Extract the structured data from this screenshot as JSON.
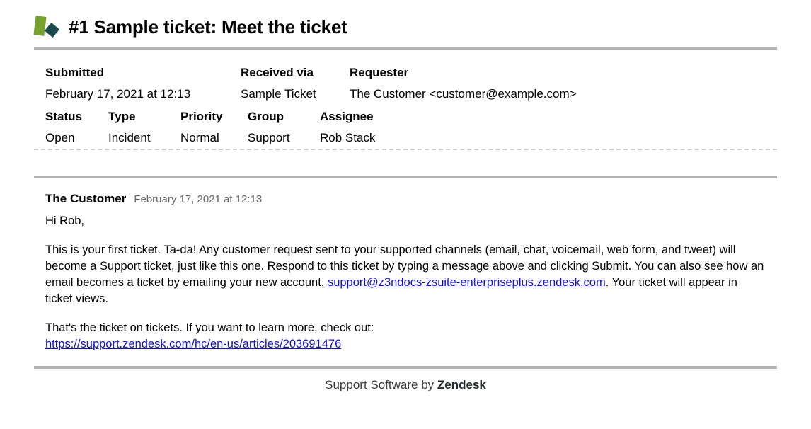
{
  "header": {
    "logo_icon": "zendesk-logo-icon",
    "title": "#1 Sample ticket: Meet the ticket"
  },
  "meta": {
    "row1": [
      {
        "label": "Submitted",
        "value": "February 17, 2021 at 12:13"
      },
      {
        "label": "Received via",
        "value": "Sample Ticket"
      },
      {
        "label": "Requester",
        "value": "The Customer <customer@example.com>"
      }
    ],
    "row2": [
      {
        "label": "Status",
        "value": "Open"
      },
      {
        "label": "Type",
        "value": "Incident"
      },
      {
        "label": "Priority",
        "value": "Normal"
      },
      {
        "label": "Group",
        "value": "Support"
      },
      {
        "label": "Assignee",
        "value": "Rob Stack"
      }
    ]
  },
  "comment": {
    "author": "The Customer",
    "date": "February 17, 2021 at 12:13",
    "greeting": "Hi Rob,",
    "paragraph_1_part_1": "This is your first ticket. Ta-da! Any customer request sent to your supported channels (email, chat, voicemail, web form, and tweet) will become a Support ticket, just like this one. Respond to this ticket by typing a message above and clicking Submit. You can also see how an email becomes a ticket by emailing your new account, ",
    "email_link": "support@z3ndocs-zsuite-enterpriseplus.zendesk.com",
    "paragraph_1_part_2": ". Your ticket will appear in ticket views.",
    "paragraph_2_text": "That's the ticket on tickets. If you want to learn more, check out:",
    "article_link": "https://support.zendesk.com/hc/en-us/articles/203691476"
  },
  "footer": {
    "text": "Support Software by ",
    "brand": "Zendesk"
  },
  "colors": {
    "logo_green": "#78a22f",
    "logo_dark": "#17494d",
    "link": "#1111cc",
    "rule": "#b3b3b3",
    "dashed_rule": "#c9c9c9",
    "muted_text": "#666666"
  }
}
